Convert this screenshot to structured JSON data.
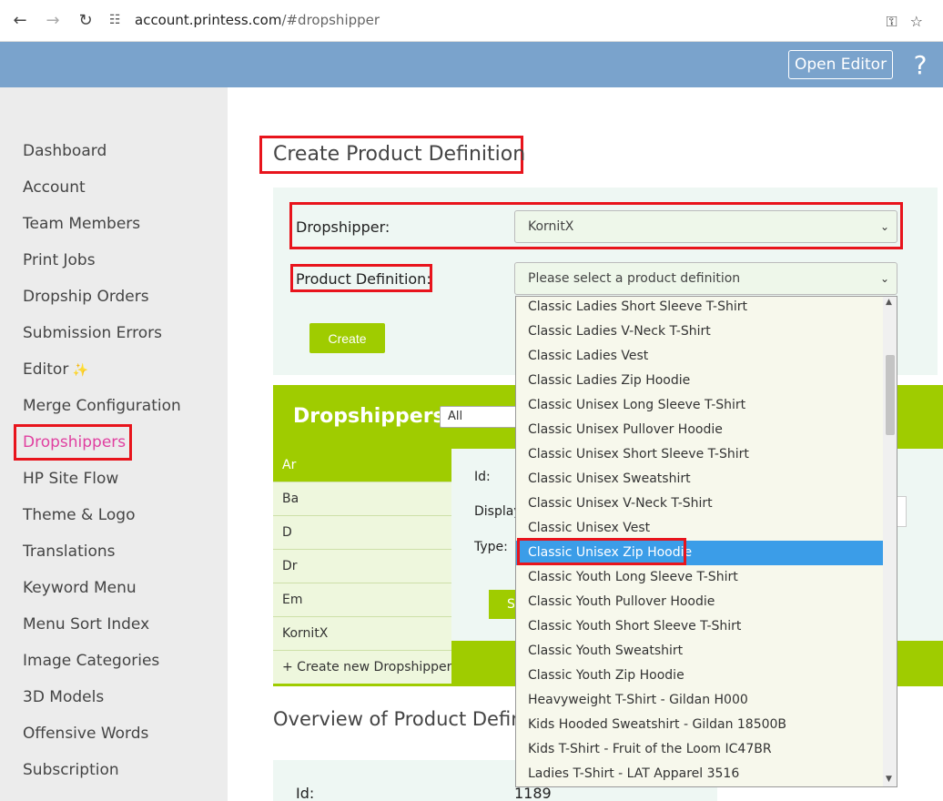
{
  "browser": {
    "url_host": "account.printess.com",
    "url_path": "/#dropshipper"
  },
  "header": {
    "open_editor_label": "Open Editor",
    "help_symbol": "?"
  },
  "sidebar": {
    "items": [
      {
        "label": "Dashboard"
      },
      {
        "label": "Account"
      },
      {
        "label": "Team Members"
      },
      {
        "label": "Print Jobs"
      },
      {
        "label": "Dropship Orders"
      },
      {
        "label": "Submission Errors"
      },
      {
        "label": "Editor"
      },
      {
        "label": "Merge Configuration"
      },
      {
        "label": "Dropshippers"
      },
      {
        "label": "HP Site Flow"
      },
      {
        "label": "Theme & Logo"
      },
      {
        "label": "Translations"
      },
      {
        "label": "Keyword Menu"
      },
      {
        "label": "Menu Sort Index"
      },
      {
        "label": "Image Categories"
      },
      {
        "label": "3D Models"
      },
      {
        "label": "Offensive Words"
      },
      {
        "label": "Subscription"
      }
    ],
    "active_index": 8
  },
  "create": {
    "title": "Create Product Definition",
    "dropshipper_label": "Dropshipper:",
    "dropshipper_value": "KornitX",
    "product_def_label": "Product Definition:",
    "product_def_placeholder": "Please select a product definition",
    "create_button": "Create"
  },
  "dropshippers": {
    "title": "Dropshippers",
    "filter_value": "All",
    "rows": [
      {
        "label": "Ar"
      },
      {
        "label": "Ba"
      },
      {
        "label": "D"
      },
      {
        "label": "Dr"
      },
      {
        "label": "Em"
      },
      {
        "label": "KornitX"
      },
      {
        "label": "+ Create new Dropshipper"
      }
    ],
    "detail": {
      "id_label": "Id:",
      "display_label": "Display",
      "type_label": "Type:",
      "save_label": "S"
    }
  },
  "overview": {
    "title": "Overview of Product Defin",
    "id_label": "Id:",
    "id_value": "1189"
  },
  "dropdown": {
    "options": [
      "Classic Ladies Short Sleeve T-Shirt",
      "Classic Ladies V-Neck T-Shirt",
      "Classic Ladies Vest",
      "Classic Ladies Zip Hoodie",
      "Classic Unisex Long Sleeve T-Shirt",
      "Classic Unisex Pullover Hoodie",
      "Classic Unisex Short Sleeve T-Shirt",
      "Classic Unisex Sweatshirt",
      "Classic Unisex V-Neck T-Shirt",
      "Classic Unisex Vest",
      "Classic Unisex Zip Hoodie",
      "Classic Youth Long Sleeve T-Shirt",
      "Classic Youth Pullover Hoodie",
      "Classic Youth Short Sleeve T-Shirt",
      "Classic Youth Sweatshirt",
      "Classic Youth Zip Hoodie",
      "Heavyweight T-Shirt - Gildan H000",
      "Kids Hooded Sweatshirt - Gildan 18500B",
      "Kids T-Shirt - Fruit of the Loom IC47BR",
      "Ladies T-Shirt - LAT Apparel 3516"
    ],
    "selected_index": 10
  },
  "colors": {
    "header_blue": "#7aa3cc",
    "accent_green": "#9fcc00",
    "active_pink": "#e040a0",
    "highlight_red": "#e8141c",
    "selected_blue": "#3b9de8"
  }
}
